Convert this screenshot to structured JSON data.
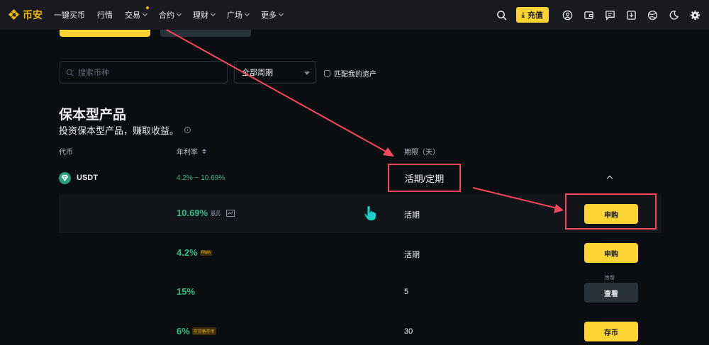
{
  "nav": {
    "logo": "币安",
    "items": [
      "一键买币",
      "行情",
      "交易",
      "合约",
      "理财",
      "广场",
      "更多"
    ],
    "deposit": "充值"
  },
  "filters": {
    "search_placeholder": "搜索币种",
    "period_value": "全部周期",
    "match_label": "匹配我的资产"
  },
  "section": {
    "title": "保本型产品",
    "subtitle": "投资保本型产品，赚取收益。"
  },
  "columns": {
    "coin": "代币",
    "apr": "年利率",
    "term": "期限（天）"
  },
  "coin": {
    "name": "USDT",
    "apr_range": "4.2% ~ 10.69%",
    "term_header": "活期/定期"
  },
  "products": [
    {
      "rate": "10.69%",
      "tag": "最高",
      "term": "活期",
      "button": "申购"
    },
    {
      "rate": "4.2%",
      "tag": "RWA",
      "term": "活期",
      "button": "申购"
    },
    {
      "rate": "15%",
      "tag": "",
      "term": "5",
      "button": "查看",
      "sold": "售罄"
    },
    {
      "rate": "6%",
      "tag": "存贷备存币",
      "term": "30",
      "button": "存币"
    }
  ],
  "colors": {
    "accent": "#fcd535",
    "positive": "#2ebd85",
    "annotation": "#f6465d"
  }
}
